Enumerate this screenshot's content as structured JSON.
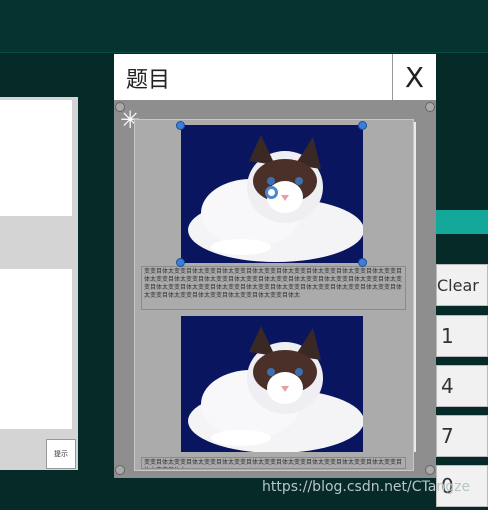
{
  "dialog": {
    "title": "题目",
    "close_label": "X"
  },
  "hint_button": "提示",
  "keypad": {
    "keys": [
      "Clear",
      "1",
      "4",
      "7",
      "0"
    ]
  },
  "question": {
    "text_block_1": "变变目体太变变目体太变变目体太变变目体太变变目体太变变目体太变变目体太变变目体太变变目体太变变目体太变变目体太变变目体太变变目体太变变目体太变变目体太变变目体太变变目体太变变目体太变变目体太变变目体太变变目体太变变目体太变变目体太变变目体太变变目体太变变目体太变变目体太变变目体太变变目体太变变目体太变变目体太",
    "text_block_2": "变变目体太变变目体太变变目体太变变目体太变变目体太变变目体太变变目体太变变目体太变变目体太变变目体太"
  },
  "watermark": "https://blog.csdn.net/CTangze",
  "icons": [
    "move-icon"
  ]
}
